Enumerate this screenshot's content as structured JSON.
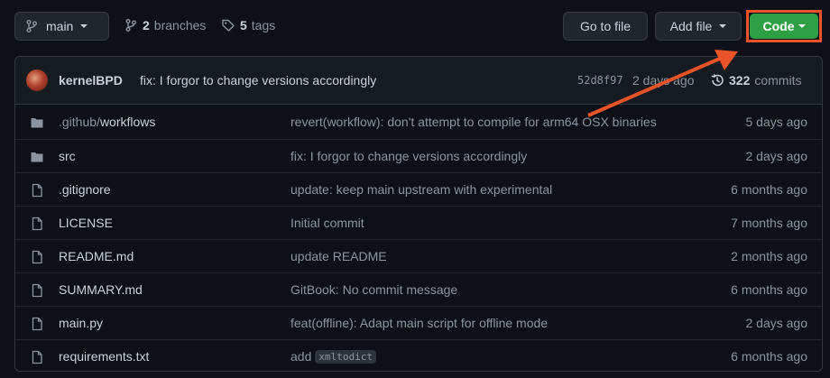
{
  "toolbar": {
    "branch": "main",
    "branches_count": "2",
    "branches_label": "branches",
    "tags_count": "5",
    "tags_label": "tags",
    "goto_file": "Go to file",
    "add_file": "Add file",
    "code": "Code"
  },
  "commit": {
    "author": "kernelBPD",
    "message": "fix: I forgor to change versions accordingly",
    "sha": "52d8f97",
    "age": "2 days ago",
    "commits_count": "322",
    "commits_label": "commits"
  },
  "files": [
    {
      "type": "folder",
      "name_dim": ".github/",
      "name": "workflows",
      "message": "revert(workflow): don't attempt to compile for arm64 OSX binaries",
      "age": "5 days ago"
    },
    {
      "type": "folder",
      "name_dim": "",
      "name": "src",
      "message": "fix: I forgor to change versions accordingly",
      "age": "2 days ago"
    },
    {
      "type": "file",
      "name_dim": "",
      "name": ".gitignore",
      "message": "update: keep main upstream with experimental",
      "age": "6 months ago"
    },
    {
      "type": "file",
      "name_dim": "",
      "name": "LICENSE",
      "message": "Initial commit",
      "age": "7 months ago"
    },
    {
      "type": "file",
      "name_dim": "",
      "name": "README.md",
      "message": "update README",
      "age": "2 months ago"
    },
    {
      "type": "file",
      "name_dim": "",
      "name": "SUMMARY.md",
      "message": "GitBook: No commit message",
      "age": "6 months ago"
    },
    {
      "type": "file",
      "name_dim": "",
      "name": "main.py",
      "message": "feat(offline): Adapt main script for offline mode",
      "age": "2 days ago"
    },
    {
      "type": "file",
      "name_dim": "",
      "name": "requirements.txt",
      "message": "add",
      "code": "xmltodict",
      "age": "6 months ago"
    }
  ],
  "colors": {
    "code_button": "#2ea043",
    "highlight": "#e8532a",
    "background": "#0d1117"
  },
  "icons": {
    "branch": "git-branch-icon",
    "tag": "tag-icon",
    "history": "history-icon",
    "folder": "folder-icon",
    "file": "file-icon"
  }
}
